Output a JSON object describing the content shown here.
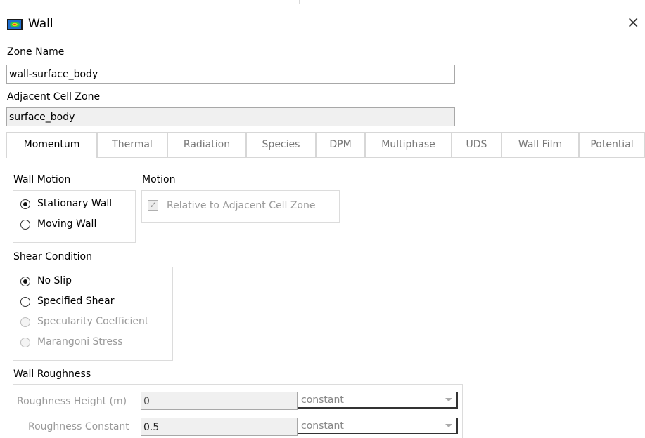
{
  "window": {
    "title": "Wall",
    "close_glyph": "×",
    "icon": "fluent-app-icon"
  },
  "zone_name": {
    "label": "Zone Name",
    "value": "wall-surface_body"
  },
  "adjacent_cell_zone": {
    "label": "Adjacent Cell Zone",
    "value": "surface_body"
  },
  "tabs": [
    {
      "label": "Momentum",
      "active": true
    },
    {
      "label": "Thermal"
    },
    {
      "label": "Radiation"
    },
    {
      "label": "Species"
    },
    {
      "label": "DPM"
    },
    {
      "label": "Multiphase"
    },
    {
      "label": "UDS"
    },
    {
      "label": "Wall Film"
    },
    {
      "label": "Potential"
    }
  ],
  "wall_motion": {
    "label": "Wall Motion",
    "options": [
      {
        "label": "Stationary Wall",
        "checked": true
      },
      {
        "label": "Moving Wall",
        "checked": false
      }
    ]
  },
  "motion": {
    "label": "Motion",
    "relative_checkbox": {
      "label": "Relative to Adjacent Cell Zone",
      "checked": true,
      "enabled": false
    }
  },
  "shear_condition": {
    "label": "Shear Condition",
    "options": [
      {
        "label": "No Slip",
        "checked": true,
        "enabled": true
      },
      {
        "label": "Specified Shear",
        "checked": false,
        "enabled": true
      },
      {
        "label": "Specularity Coefficient",
        "checked": false,
        "enabled": false
      },
      {
        "label": "Marangoni Stress",
        "checked": false,
        "enabled": false
      }
    ]
  },
  "wall_roughness": {
    "label": "Wall Roughness",
    "height": {
      "label": "Roughness Height (m)",
      "value": "0",
      "method": "constant"
    },
    "constant": {
      "label": "Roughness Constant",
      "value": "0.5",
      "method": "constant"
    }
  },
  "colors": {
    "accent_line": "#bfd5ea",
    "disabled_text": "#9a9a9a",
    "border": "#a8a8a8"
  }
}
